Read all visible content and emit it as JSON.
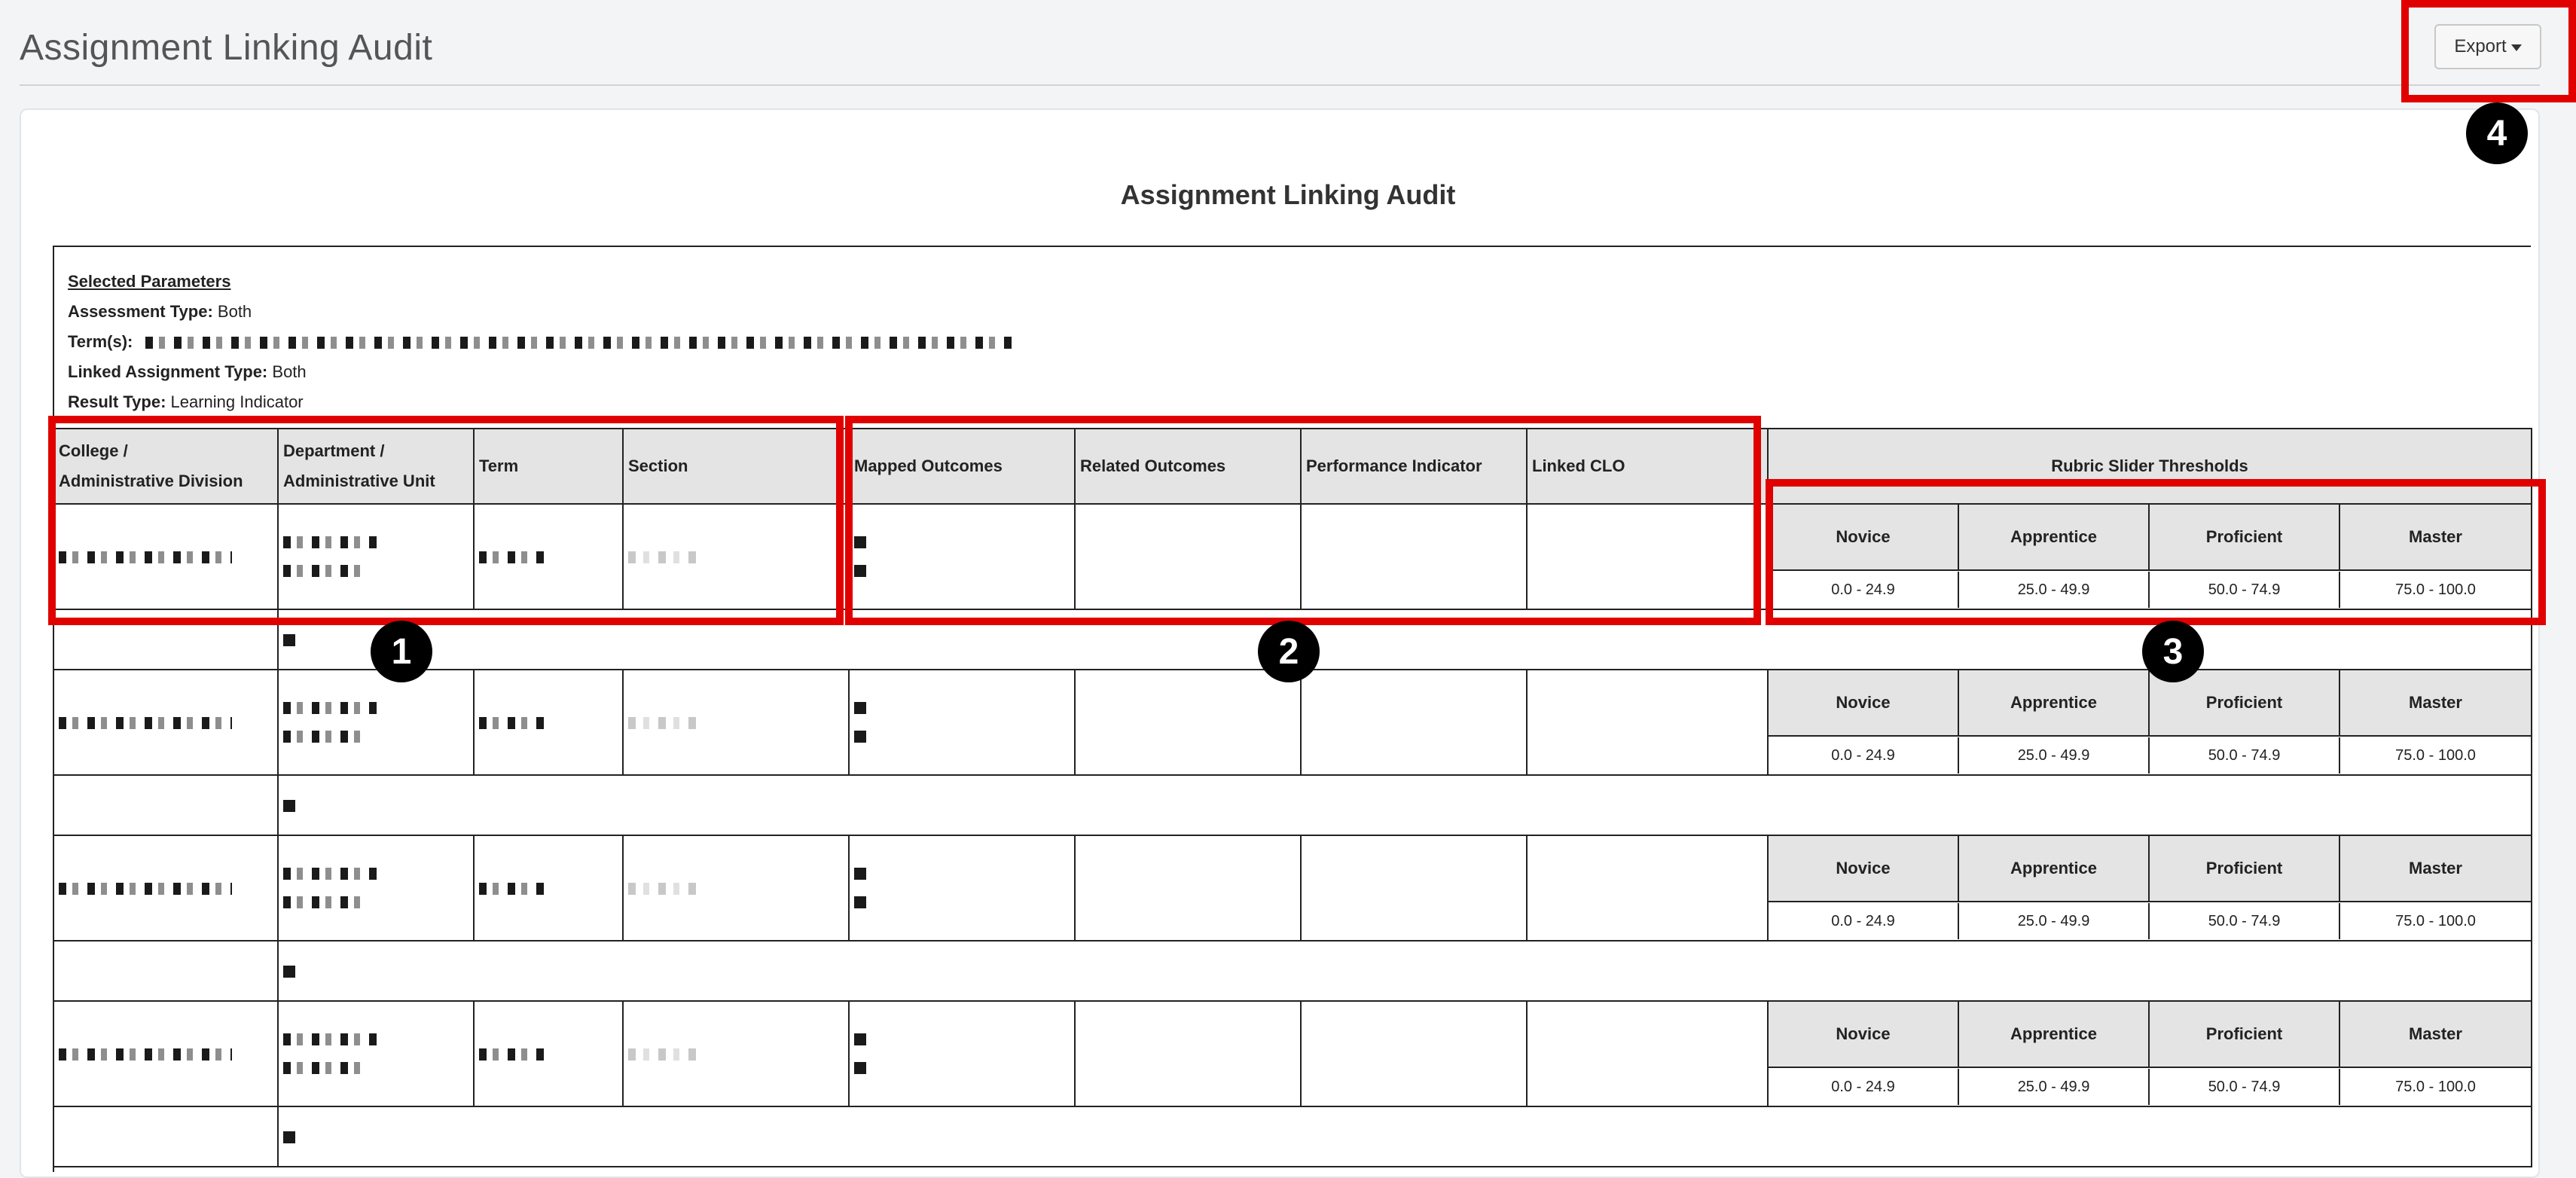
{
  "page": {
    "title": "Assignment Linking Audit",
    "export_label": "Export"
  },
  "report": {
    "title": "Assignment Linking Audit",
    "params": {
      "heading": "Selected Parameters",
      "assessment_type_label": "Assessment Type:",
      "assessment_type_value": "Both",
      "terms_label": "Term(s):",
      "linked_assignment_type_label": "Linked Assignment Type:",
      "linked_assignment_type_value": "Both",
      "result_type_label": "Result Type:",
      "result_type_value": "Learning Indicator"
    }
  },
  "table": {
    "columns": {
      "college_l1": "College /",
      "college_l2": "Administrative Division",
      "department_l1": "Department /",
      "department_l2": "Administrative Unit",
      "term": "Term",
      "section": "Section",
      "mapped_outcomes": "Mapped Outcomes",
      "related_outcomes": "Related Outcomes",
      "performance_indicator": "Performance Indicator",
      "linked_clo": "Linked CLO",
      "rubric_thresholds": "Rubric Slider Thresholds"
    },
    "thresholds": [
      {
        "label": "Novice",
        "range": "0.0 - 24.9"
      },
      {
        "label": "Apprentice",
        "range": "25.0 - 49.9"
      },
      {
        "label": "Proficient",
        "range": "50.0 - 74.9"
      },
      {
        "label": "Master",
        "range": "75.0 - 100.0"
      }
    ]
  },
  "annotations": {
    "b1": "1",
    "b2": "2",
    "b3": "3",
    "b4": "4",
    "color": "#e10000"
  }
}
